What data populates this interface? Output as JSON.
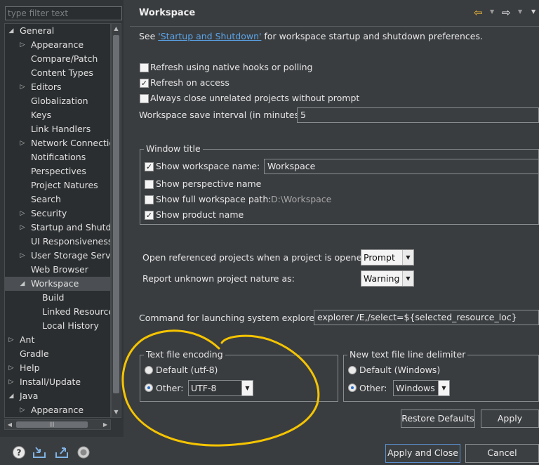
{
  "filter": {
    "placeholder": "type filter text"
  },
  "tree": [
    {
      "label": "General",
      "level": 0,
      "twisty": "open"
    },
    {
      "label": "Appearance",
      "level": 1,
      "twisty": "closed"
    },
    {
      "label": "Compare/Patch",
      "level": 1,
      "twisty": "none"
    },
    {
      "label": "Content Types",
      "level": 1,
      "twisty": "none"
    },
    {
      "label": "Editors",
      "level": 1,
      "twisty": "closed"
    },
    {
      "label": "Globalization",
      "level": 1,
      "twisty": "none"
    },
    {
      "label": "Keys",
      "level": 1,
      "twisty": "none"
    },
    {
      "label": "Link Handlers",
      "level": 1,
      "twisty": "none"
    },
    {
      "label": "Network Connections",
      "level": 1,
      "twisty": "closed"
    },
    {
      "label": "Notifications",
      "level": 1,
      "twisty": "none"
    },
    {
      "label": "Perspectives",
      "level": 1,
      "twisty": "none"
    },
    {
      "label": "Project Natures",
      "level": 1,
      "twisty": "none"
    },
    {
      "label": "Search",
      "level": 1,
      "twisty": "none"
    },
    {
      "label": "Security",
      "level": 1,
      "twisty": "closed"
    },
    {
      "label": "Startup and Shutdown",
      "level": 1,
      "twisty": "closed"
    },
    {
      "label": "UI Responsiveness",
      "level": 1,
      "twisty": "none"
    },
    {
      "label": "User Storage Service",
      "level": 1,
      "twisty": "closed"
    },
    {
      "label": "Web Browser",
      "level": 1,
      "twisty": "none"
    },
    {
      "label": "Workspace",
      "level": 1,
      "twisty": "open",
      "selected": true
    },
    {
      "label": "Build",
      "level": 2,
      "twisty": "none"
    },
    {
      "label": "Linked Resources",
      "level": 2,
      "twisty": "none"
    },
    {
      "label": "Local History",
      "level": 2,
      "twisty": "none"
    },
    {
      "label": "Ant",
      "level": 0,
      "twisty": "closed"
    },
    {
      "label": "Gradle",
      "level": 0,
      "twisty": "none"
    },
    {
      "label": "Help",
      "level": 0,
      "twisty": "closed"
    },
    {
      "label": "Install/Update",
      "level": 0,
      "twisty": "closed"
    },
    {
      "label": "Java",
      "level": 0,
      "twisty": "open"
    },
    {
      "label": "Appearance",
      "level": 1,
      "twisty": "closed"
    }
  ],
  "page": {
    "title": "Workspace",
    "intro_prefix": "See ",
    "intro_link": "'Startup and Shutdown'",
    "intro_suffix": " for workspace startup and shutdown preferences."
  },
  "options": {
    "refresh_native": {
      "label": "Refresh using native hooks or polling",
      "checked": false
    },
    "refresh_access": {
      "label": "Refresh on access",
      "checked": true
    },
    "close_unrelated": {
      "label": "Always close unrelated projects without prompt",
      "checked": false
    },
    "save_interval_label": "Workspace save interval (in minutes):",
    "save_interval_value": "5"
  },
  "window_title": {
    "legend": "Window title",
    "show_workspace_name": {
      "label": "Show workspace name:",
      "checked": true
    },
    "workspace_name_value": "Workspace",
    "show_perspective_name": {
      "label": "Show perspective name",
      "checked": false
    },
    "show_full_path": {
      "label": "Show full workspace path:",
      "checked": false
    },
    "full_path_value": "D:\\Workspace",
    "show_product_name": {
      "label": "Show product name",
      "checked": true
    }
  },
  "projects": {
    "open_referenced_label": "Open referenced projects when a project is opened:",
    "open_referenced_value": "Prompt",
    "unknown_nature_label": "Report unknown project nature as:",
    "unknown_nature_value": "Warning"
  },
  "explorer": {
    "label": "Command for launching system explorer:",
    "value": "explorer /E,/select=${selected_resource_loc}"
  },
  "encoding": {
    "legend": "Text file encoding",
    "default_label": "Default (utf-8)",
    "other_label": "Other:",
    "other_value": "UTF-8"
  },
  "line_delimiter": {
    "legend": "New text file line delimiter",
    "default_label": "Default (Windows)",
    "other_label": "Other:",
    "other_value": "Windows"
  },
  "buttons": {
    "restore_defaults": "Restore Defaults",
    "apply": "Apply",
    "apply_and_close": "Apply and Close",
    "cancel": "Cancel"
  },
  "icons": {
    "back": "back-arrow-icon",
    "forward": "forward-arrow-icon",
    "view_menu": "view-menu-icon",
    "help": "help-icon",
    "import": "import-icon",
    "export": "export-icon",
    "record": "oomph-record-icon"
  },
  "colors": {
    "background": "#3a3d40",
    "tree_background": "#2b2e30",
    "link": "#5aa3e6",
    "annotation": "#f5c400",
    "nav_arrow": "#f0b93a"
  }
}
